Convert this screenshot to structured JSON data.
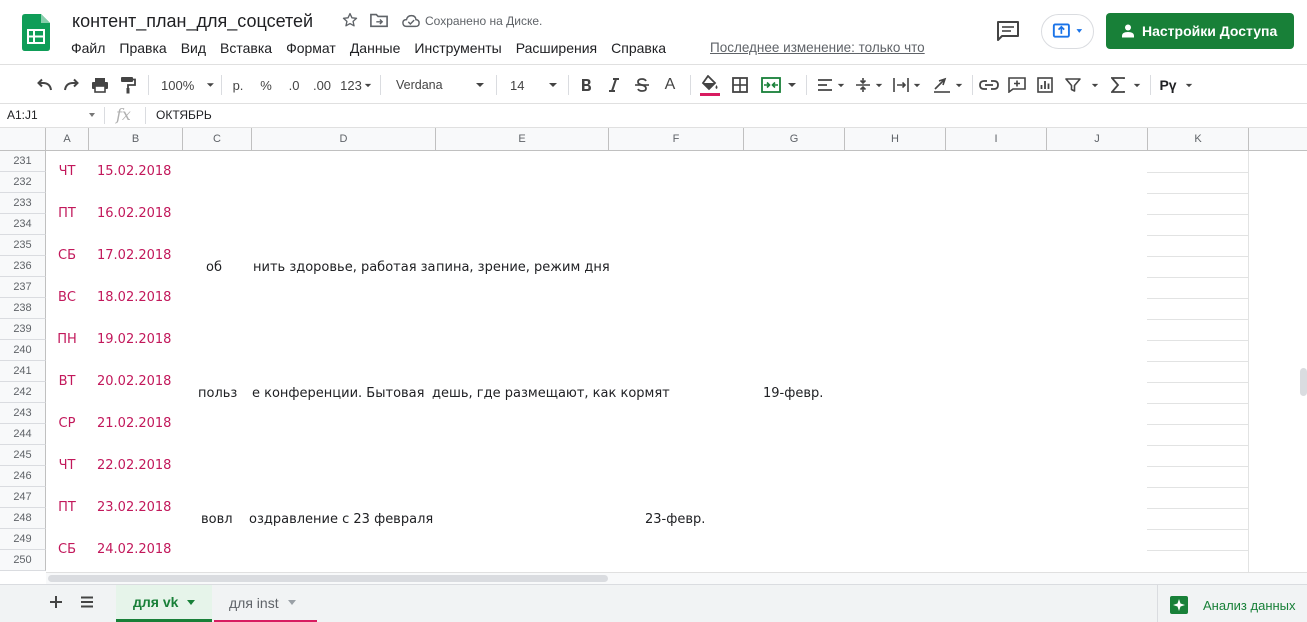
{
  "document": {
    "title": "контент_план_для_соцсетей",
    "save_status": "Сохранено на Диске.",
    "last_edit": "Последнее изменение: только что"
  },
  "menu": {
    "items": [
      "Файл",
      "Правка",
      "Вид",
      "Вставка",
      "Формат",
      "Данные",
      "Инструменты",
      "Расширения",
      "Справка"
    ]
  },
  "header": {
    "share_label": "Настройки Доступа"
  },
  "toolbar": {
    "zoom": "100%",
    "currency": "р.",
    "percent": "%",
    "decimal_decrease": ".0",
    "decimal_increase": ".00",
    "number_format": "123",
    "font": "Verdana",
    "font_size": "14",
    "text_color_letter": "A",
    "input_tools": "Рү"
  },
  "formula_bar": {
    "name_box": "A1:J1",
    "fx": "fx",
    "value": "ОКТЯБРЬ"
  },
  "grid": {
    "columns": [
      "A",
      "B",
      "C",
      "D",
      "E",
      "F",
      "G",
      "H",
      "I",
      "J",
      "K"
    ],
    "row_numbers": [
      231,
      232,
      233,
      234,
      235,
      236,
      237,
      238,
      239,
      240,
      241,
      242,
      243,
      244,
      245,
      246,
      247,
      248,
      249,
      250
    ],
    "date_rows": [
      {
        "day": "ЧТ",
        "date": "15.02.2018"
      },
      {
        "day": "ПТ",
        "date": "16.02.2018"
      },
      {
        "day": "СБ",
        "date": "17.02.2018"
      },
      {
        "day": "ВС",
        "date": "18.02.2018"
      },
      {
        "day": "ПН",
        "date": "19.02.2018"
      },
      {
        "day": "ВТ",
        "date": "20.02.2018"
      },
      {
        "day": "СР",
        "date": "21.02.2018"
      },
      {
        "day": "ЧТ",
        "date": "22.02.2018"
      },
      {
        "day": "ПТ",
        "date": "23.02.2018"
      },
      {
        "day": "СБ",
        "date": "24.02.2018"
      }
    ],
    "text_row_236": {
      "c": "об",
      "d": "нить здоровье, работая за",
      "e": "пина, зрение, режим дня"
    },
    "text_row_242": {
      "c": "польз",
      "d": "е конференции. Бытовая",
      "e": "дешь, где размещают, как кормят",
      "g": "19-февр."
    },
    "text_row_248": {
      "c": "вовл",
      "d": "оздравление с 23 февраля",
      "f": "23-февр."
    }
  },
  "tabs": {
    "sheet1": "для vk",
    "sheet2": "для inst",
    "explore": "Анализ данных"
  },
  "colors": {
    "accent_green": "#188038",
    "date_magenta": "#c2185b",
    "tab_underline": "#d81b60"
  }
}
